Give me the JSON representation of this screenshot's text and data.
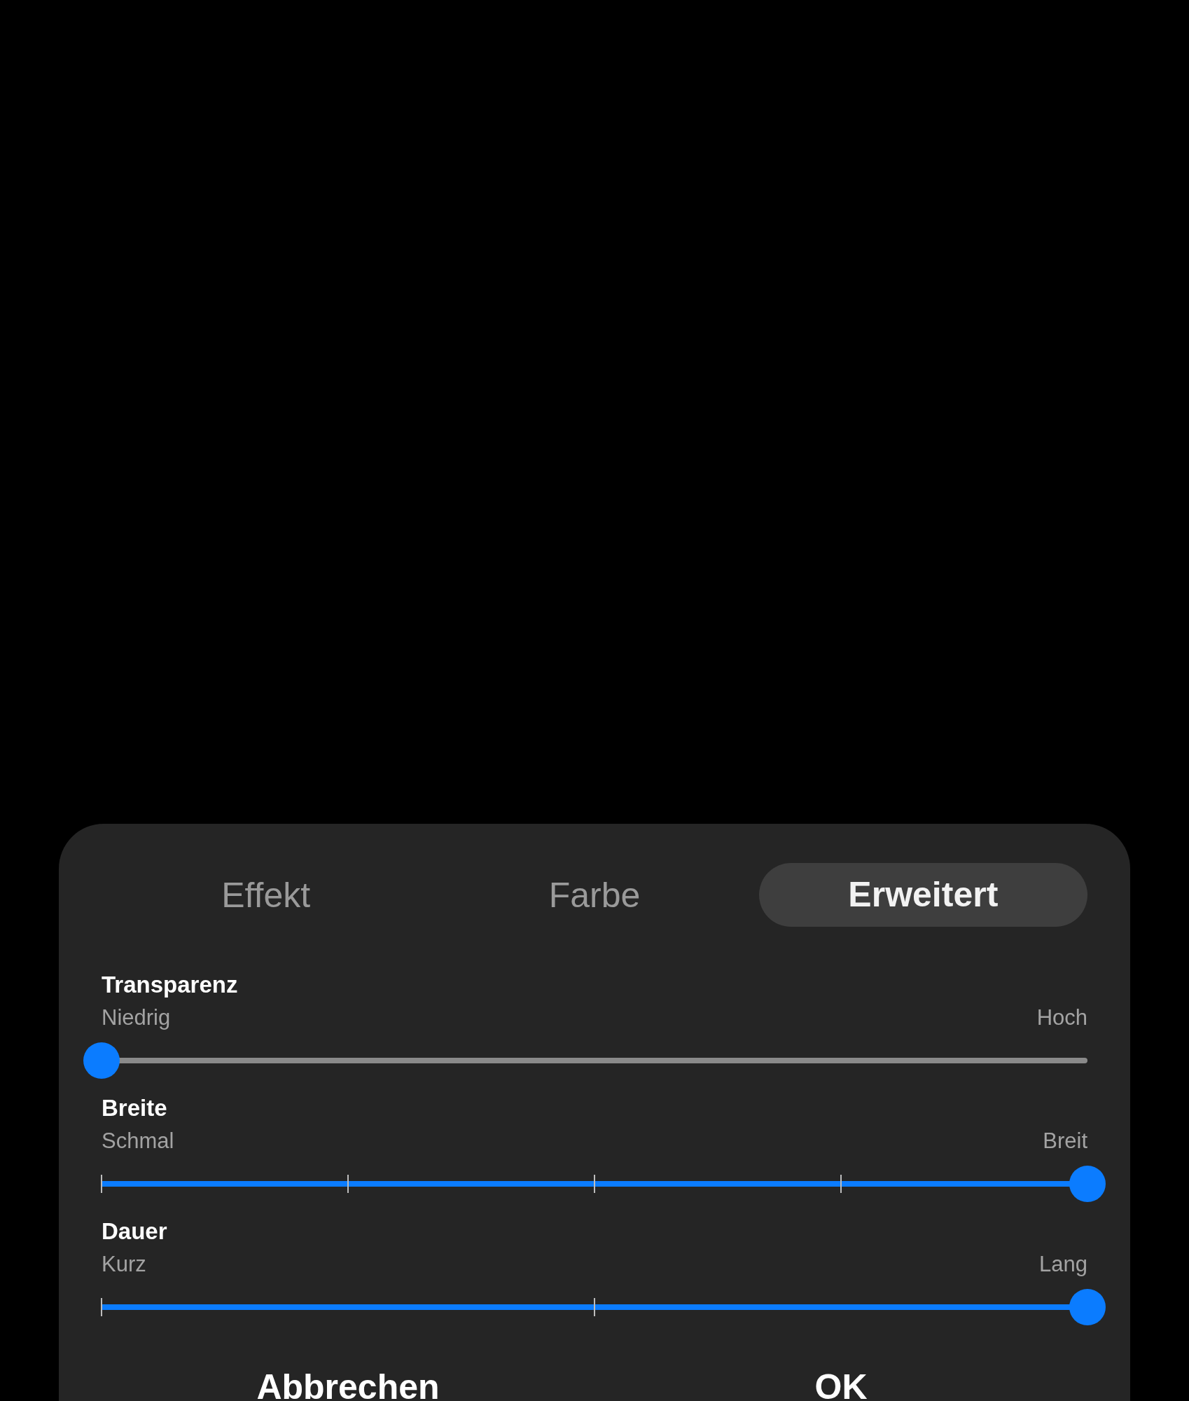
{
  "tabs": [
    {
      "label": "Effekt",
      "selected": false
    },
    {
      "label": "Farbe",
      "selected": false
    },
    {
      "label": "Erweitert",
      "selected": true
    }
  ],
  "sliders": [
    {
      "kind": "continuous",
      "label": "Transparenz",
      "min_label": "Niedrig",
      "max_label": "Hoch",
      "level": 0
    },
    {
      "kind": "five-stop",
      "label": "Breite",
      "min_label": "Schmal",
      "max_label": "Breit",
      "level": 1
    },
    {
      "kind": "three-stop",
      "label": "Dauer",
      "min_label": "Kurz",
      "max_label": "Lang",
      "level": 1
    }
  ],
  "buttons": [
    "Abbrechen",
    "OK"
  ]
}
